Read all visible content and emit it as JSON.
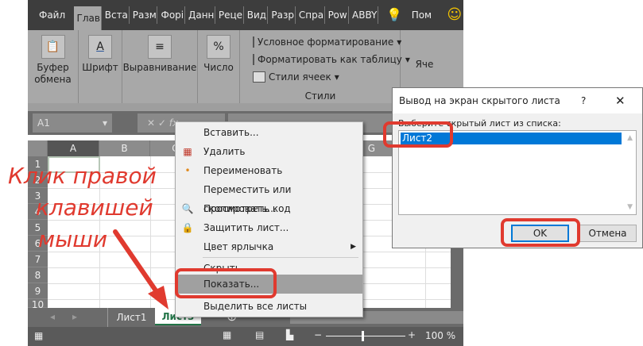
{
  "ribbon_tabs": [
    "Файл",
    "Глав",
    "Вста",
    "Разм",
    "Форі",
    "Данн",
    "Реце",
    "Вид",
    "Разр",
    "Спра",
    "Pow",
    "ABBY",
    "Пом"
  ],
  "ribbon": {
    "clipboard": "Буфер обмена",
    "font": "Шрифт",
    "alignment": "Выравнивание",
    "number": "Число",
    "conditional": "Условное форматирование",
    "format_table": "Форматировать как таблицу",
    "cell_styles": "Стили ячеек",
    "styles_group": "Стили",
    "cells": "Яче"
  },
  "formula_bar": {
    "name_box": "A1",
    "fx": "fx"
  },
  "columns": [
    "A",
    "B",
    "C",
    "G"
  ],
  "rows": [
    "1",
    "2",
    "3",
    "4",
    "5",
    "6",
    "7",
    "8",
    "9",
    "10"
  ],
  "sheet_tabs": [
    "Лист1",
    "Лист3"
  ],
  "status": {
    "zoom": "100 %"
  },
  "context_menu": [
    "Вставить...",
    "Удалить",
    "Переименовать",
    "Переместить или скопировать...",
    "Просмотреть код",
    "Защитить лист...",
    "Цвет ярлычка",
    "Скрыть",
    "Показать...",
    "Выделить все листы"
  ],
  "dialog": {
    "title": "Вывод на экран скрытого листа",
    "help": "?",
    "close": "✕",
    "prompt": "Выберите скрытый лист из списка:",
    "items": [
      "Лист2"
    ],
    "ok": "OK",
    "cancel": "Отмена"
  },
  "annotation": {
    "line1": "Клик правой",
    "line2": "клавишей",
    "line3": "мыши"
  },
  "colors": {
    "accent": "#0078d7",
    "annotation": "#e03a2f",
    "active_tab": "#217346"
  }
}
